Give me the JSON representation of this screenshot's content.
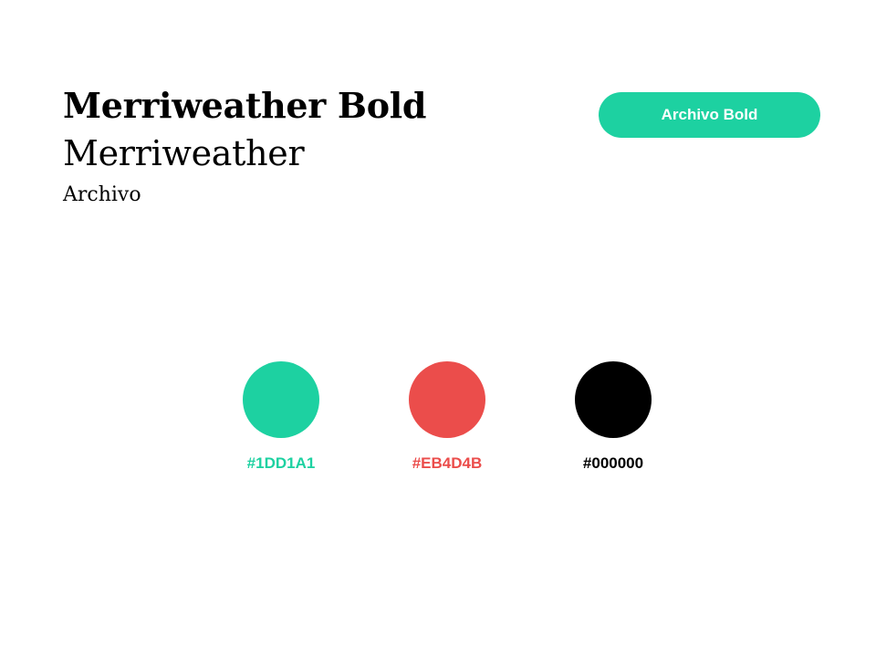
{
  "typography": {
    "heading_bold": "Merriweather Bold",
    "heading_regular": "Merriweather",
    "body": "Archivo"
  },
  "button": {
    "label": "Archivo Bold",
    "color": "#1DD1A1"
  },
  "palette": [
    {
      "hex": "#1DD1A1",
      "color": "#1DD1A1"
    },
    {
      "hex": "#EB4D4B",
      "color": "#EB4D4B"
    },
    {
      "hex": "#000000",
      "color": "#000000"
    }
  ]
}
